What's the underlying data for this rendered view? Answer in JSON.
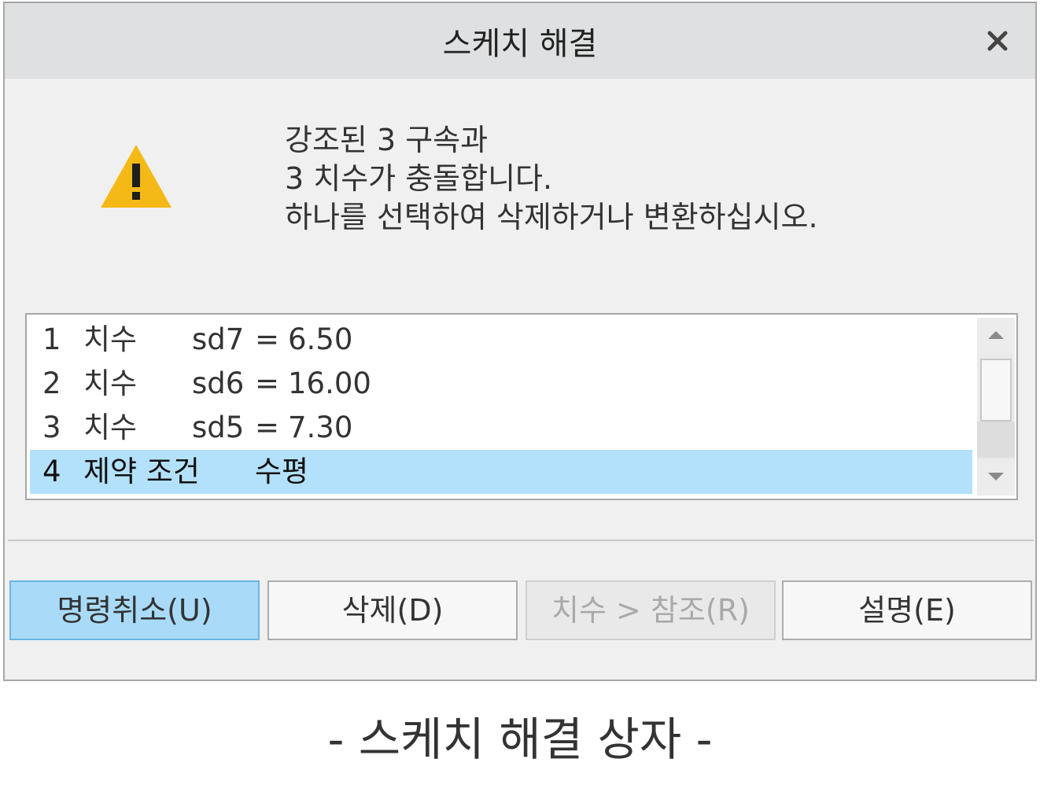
{
  "dialog": {
    "title": "스케치 해결",
    "close_icon": "close-icon",
    "warning_icon": "warning-triangle-icon",
    "warning_color": "#f4b916",
    "message": [
      "강조된 3 구속과",
      "3 치수가 충돌합니다.",
      "하나를 선택하여 삭제하거나 변환하십시오."
    ],
    "list": {
      "rows": [
        {
          "num": "1",
          "type": "치수",
          "name": "sd7",
          "eq": "=",
          "value": "6.50"
        },
        {
          "num": "2",
          "type": "치수",
          "name": "sd6",
          "eq": "=",
          "value": "16.00"
        },
        {
          "num": "3",
          "type": "치수",
          "name": "sd5",
          "eq": "=",
          "value": "7.30"
        },
        {
          "num": "4",
          "type": "제약 조건",
          "desc": "수평",
          "selected": true
        }
      ]
    },
    "buttons": {
      "undo": "명령취소(U)",
      "delete": "삭제(D)",
      "dim_to_ref": "치수 > 참조(R)",
      "explain": "설명(E)"
    }
  },
  "caption": "- 스케치 해결 상자 -",
  "colors": {
    "selected_row": "#b3e1fb",
    "primary_button": "#a9dbf8"
  }
}
